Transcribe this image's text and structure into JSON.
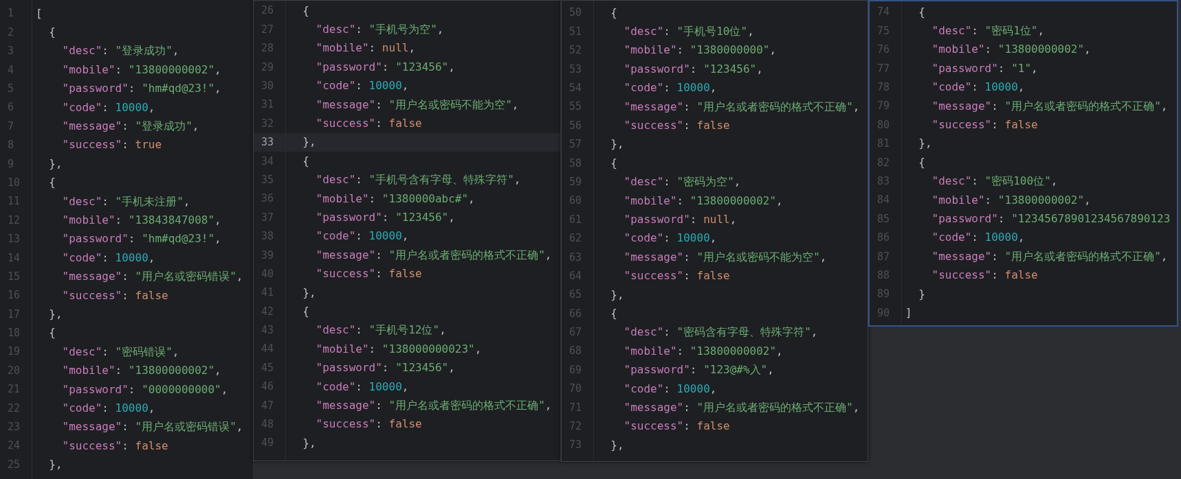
{
  "panes": [
    {
      "focused": false,
      "lines": [
        {
          "number": "1",
          "current": false,
          "tokens": [
            {
              "kind": "punct",
              "text": "["
            }
          ]
        },
        {
          "number": "2",
          "current": false,
          "tokens": [
            {
              "kind": "punct",
              "text": "  {"
            }
          ]
        },
        {
          "number": "3",
          "current": false,
          "tokens": [
            {
              "kind": "key",
              "text": "    \"desc\""
            },
            {
              "kind": "punct",
              "text": ": "
            },
            {
              "kind": "string",
              "text": "\"登录成功\""
            },
            {
              "kind": "punct",
              "text": ","
            }
          ]
        },
        {
          "number": "4",
          "current": false,
          "tokens": [
            {
              "kind": "key",
              "text": "    \"mobile\""
            },
            {
              "kind": "punct",
              "text": ": "
            },
            {
              "kind": "string",
              "text": "\"13800000002\""
            },
            {
              "kind": "punct",
              "text": ","
            }
          ]
        },
        {
          "number": "5",
          "current": false,
          "tokens": [
            {
              "kind": "key",
              "text": "    \"password\""
            },
            {
              "kind": "punct",
              "text": ": "
            },
            {
              "kind": "string",
              "text": "\"hm#qd@23!\""
            },
            {
              "kind": "punct",
              "text": ","
            }
          ]
        },
        {
          "number": "6",
          "current": false,
          "tokens": [
            {
              "kind": "key",
              "text": "    \"code\""
            },
            {
              "kind": "punct",
              "text": ": "
            },
            {
              "kind": "number",
              "text": "10000"
            },
            {
              "kind": "punct",
              "text": ","
            }
          ]
        },
        {
          "number": "7",
          "current": false,
          "tokens": [
            {
              "kind": "key",
              "text": "    \"message\""
            },
            {
              "kind": "punct",
              "text": ": "
            },
            {
              "kind": "string",
              "text": "\"登录成功\""
            },
            {
              "kind": "punct",
              "text": ","
            }
          ]
        },
        {
          "number": "8",
          "current": false,
          "tokens": [
            {
              "kind": "key",
              "text": "    \"success\""
            },
            {
              "kind": "punct",
              "text": ": "
            },
            {
              "kind": "keyword",
              "text": "true"
            }
          ]
        },
        {
          "number": "9",
          "current": false,
          "tokens": [
            {
              "kind": "punct",
              "text": "  },"
            }
          ]
        },
        {
          "number": "10",
          "current": false,
          "tokens": [
            {
              "kind": "punct",
              "text": "  {"
            }
          ]
        },
        {
          "number": "11",
          "current": false,
          "tokens": [
            {
              "kind": "key",
              "text": "    \"desc\""
            },
            {
              "kind": "punct",
              "text": ": "
            },
            {
              "kind": "string",
              "text": "\"手机未注册\""
            },
            {
              "kind": "punct",
              "text": ","
            }
          ]
        },
        {
          "number": "12",
          "current": false,
          "tokens": [
            {
              "kind": "key",
              "text": "    \"mobile\""
            },
            {
              "kind": "punct",
              "text": ": "
            },
            {
              "kind": "string",
              "text": "\"13843847008\""
            },
            {
              "kind": "punct",
              "text": ","
            }
          ]
        },
        {
          "number": "13",
          "current": false,
          "tokens": [
            {
              "kind": "key",
              "text": "    \"password\""
            },
            {
              "kind": "punct",
              "text": ": "
            },
            {
              "kind": "string",
              "text": "\"hm#qd@23!\""
            },
            {
              "kind": "punct",
              "text": ","
            }
          ]
        },
        {
          "number": "14",
          "current": false,
          "tokens": [
            {
              "kind": "key",
              "text": "    \"code\""
            },
            {
              "kind": "punct",
              "text": ": "
            },
            {
              "kind": "number",
              "text": "10000"
            },
            {
              "kind": "punct",
              "text": ","
            }
          ]
        },
        {
          "number": "15",
          "current": false,
          "tokens": [
            {
              "kind": "key",
              "text": "    \"message\""
            },
            {
              "kind": "punct",
              "text": ": "
            },
            {
              "kind": "string",
              "text": "\"用户名或密码错误\""
            },
            {
              "kind": "punct",
              "text": ","
            }
          ]
        },
        {
          "number": "16",
          "current": false,
          "tokens": [
            {
              "kind": "key",
              "text": "    \"success\""
            },
            {
              "kind": "punct",
              "text": ": "
            },
            {
              "kind": "keyword",
              "text": "false"
            }
          ]
        },
        {
          "number": "17",
          "current": false,
          "tokens": [
            {
              "kind": "punct",
              "text": "  },"
            }
          ]
        },
        {
          "number": "18",
          "current": false,
          "tokens": [
            {
              "kind": "punct",
              "text": "  {"
            }
          ]
        },
        {
          "number": "19",
          "current": false,
          "tokens": [
            {
              "kind": "key",
              "text": "    \"desc\""
            },
            {
              "kind": "punct",
              "text": ": "
            },
            {
              "kind": "string",
              "text": "\"密码错误\""
            },
            {
              "kind": "punct",
              "text": ","
            }
          ]
        },
        {
          "number": "20",
          "current": false,
          "tokens": [
            {
              "kind": "key",
              "text": "    \"mobile\""
            },
            {
              "kind": "punct",
              "text": ": "
            },
            {
              "kind": "string",
              "text": "\"13800000002\""
            },
            {
              "kind": "punct",
              "text": ","
            }
          ]
        },
        {
          "number": "21",
          "current": false,
          "tokens": [
            {
              "kind": "key",
              "text": "    \"password\""
            },
            {
              "kind": "punct",
              "text": ": "
            },
            {
              "kind": "string",
              "text": "\"0000000000\""
            },
            {
              "kind": "punct",
              "text": ","
            }
          ]
        },
        {
          "number": "22",
          "current": false,
          "tokens": [
            {
              "kind": "key",
              "text": "    \"code\""
            },
            {
              "kind": "punct",
              "text": ": "
            },
            {
              "kind": "number",
              "text": "10000"
            },
            {
              "kind": "punct",
              "text": ","
            }
          ]
        },
        {
          "number": "23",
          "current": false,
          "tokens": [
            {
              "kind": "key",
              "text": "    \"message\""
            },
            {
              "kind": "punct",
              "text": ": "
            },
            {
              "kind": "string",
              "text": "\"用户名或密码错误\""
            },
            {
              "kind": "punct",
              "text": ","
            }
          ]
        },
        {
          "number": "24",
          "current": false,
          "tokens": [
            {
              "kind": "key",
              "text": "    \"success\""
            },
            {
              "kind": "punct",
              "text": ": "
            },
            {
              "kind": "keyword",
              "text": "false"
            }
          ]
        },
        {
          "number": "25",
          "current": false,
          "tokens": [
            {
              "kind": "punct",
              "text": "  },"
            }
          ]
        }
      ]
    },
    {
      "focused": false,
      "lines": [
        {
          "number": "26",
          "current": false,
          "tokens": [
            {
              "kind": "punct",
              "text": "  {"
            }
          ]
        },
        {
          "number": "27",
          "current": false,
          "tokens": [
            {
              "kind": "key",
              "text": "    \"desc\""
            },
            {
              "kind": "punct",
              "text": ": "
            },
            {
              "kind": "string",
              "text": "\"手机号为空\""
            },
            {
              "kind": "punct",
              "text": ","
            }
          ]
        },
        {
          "number": "28",
          "current": false,
          "tokens": [
            {
              "kind": "key",
              "text": "    \"mobile\""
            },
            {
              "kind": "punct",
              "text": ": "
            },
            {
              "kind": "keyword",
              "text": "null"
            },
            {
              "kind": "punct",
              "text": ","
            }
          ]
        },
        {
          "number": "29",
          "current": false,
          "tokens": [
            {
              "kind": "key",
              "text": "    \"password\""
            },
            {
              "kind": "punct",
              "text": ": "
            },
            {
              "kind": "string",
              "text": "\"123456\""
            },
            {
              "kind": "punct",
              "text": ","
            }
          ]
        },
        {
          "number": "30",
          "current": false,
          "tokens": [
            {
              "kind": "key",
              "text": "    \"code\""
            },
            {
              "kind": "punct",
              "text": ": "
            },
            {
              "kind": "number",
              "text": "10000"
            },
            {
              "kind": "punct",
              "text": ","
            }
          ]
        },
        {
          "number": "31",
          "current": false,
          "tokens": [
            {
              "kind": "key",
              "text": "    \"message\""
            },
            {
              "kind": "punct",
              "text": ": "
            },
            {
              "kind": "string",
              "text": "\"用户名或密码不能为空\""
            },
            {
              "kind": "punct",
              "text": ","
            }
          ]
        },
        {
          "number": "32",
          "current": false,
          "tokens": [
            {
              "kind": "key",
              "text": "    \"success\""
            },
            {
              "kind": "punct",
              "text": ": "
            },
            {
              "kind": "keyword",
              "text": "false"
            }
          ]
        },
        {
          "number": "33",
          "current": true,
          "tokens": [
            {
              "kind": "punct",
              "text": "  },"
            }
          ]
        },
        {
          "number": "34",
          "current": false,
          "tokens": [
            {
              "kind": "punct",
              "text": "  {"
            }
          ]
        },
        {
          "number": "35",
          "current": false,
          "tokens": [
            {
              "kind": "key",
              "text": "    \"desc\""
            },
            {
              "kind": "punct",
              "text": ": "
            },
            {
              "kind": "string",
              "text": "\"手机号含有字母、特殊字符\""
            },
            {
              "kind": "punct",
              "text": ","
            }
          ]
        },
        {
          "number": "36",
          "current": false,
          "tokens": [
            {
              "kind": "key",
              "text": "    \"mobile\""
            },
            {
              "kind": "punct",
              "text": ": "
            },
            {
              "kind": "string",
              "text": "\"1380000abc#\""
            },
            {
              "kind": "punct",
              "text": ","
            }
          ]
        },
        {
          "number": "37",
          "current": false,
          "tokens": [
            {
              "kind": "key",
              "text": "    \"password\""
            },
            {
              "kind": "punct",
              "text": ": "
            },
            {
              "kind": "string",
              "text": "\"123456\""
            },
            {
              "kind": "punct",
              "text": ","
            }
          ]
        },
        {
          "number": "38",
          "current": false,
          "tokens": [
            {
              "kind": "key",
              "text": "    \"code\""
            },
            {
              "kind": "punct",
              "text": ": "
            },
            {
              "kind": "number",
              "text": "10000"
            },
            {
              "kind": "punct",
              "text": ","
            }
          ]
        },
        {
          "number": "39",
          "current": false,
          "tokens": [
            {
              "kind": "key",
              "text": "    \"message\""
            },
            {
              "kind": "punct",
              "text": ": "
            },
            {
              "kind": "string",
              "text": "\"用户名或者密码的格式不正确\""
            },
            {
              "kind": "punct",
              "text": ","
            }
          ]
        },
        {
          "number": "40",
          "current": false,
          "tokens": [
            {
              "kind": "key",
              "text": "    \"success\""
            },
            {
              "kind": "punct",
              "text": ": "
            },
            {
              "kind": "keyword",
              "text": "false"
            }
          ]
        },
        {
          "number": "41",
          "current": false,
          "tokens": [
            {
              "kind": "punct",
              "text": "  },"
            }
          ]
        },
        {
          "number": "42",
          "current": false,
          "tokens": [
            {
              "kind": "punct",
              "text": "  {"
            }
          ]
        },
        {
          "number": "43",
          "current": false,
          "tokens": [
            {
              "kind": "key",
              "text": "    \"desc\""
            },
            {
              "kind": "punct",
              "text": ": "
            },
            {
              "kind": "string",
              "text": "\"手机号12位\""
            },
            {
              "kind": "punct",
              "text": ","
            }
          ]
        },
        {
          "number": "44",
          "current": false,
          "tokens": [
            {
              "kind": "key",
              "text": "    \"mobile\""
            },
            {
              "kind": "punct",
              "text": ": "
            },
            {
              "kind": "string",
              "text": "\"138000000023\""
            },
            {
              "kind": "punct",
              "text": ","
            }
          ]
        },
        {
          "number": "45",
          "current": false,
          "tokens": [
            {
              "kind": "key",
              "text": "    \"password\""
            },
            {
              "kind": "punct",
              "text": ": "
            },
            {
              "kind": "string",
              "text": "\"123456\""
            },
            {
              "kind": "punct",
              "text": ","
            }
          ]
        },
        {
          "number": "46",
          "current": false,
          "tokens": [
            {
              "kind": "key",
              "text": "    \"code\""
            },
            {
              "kind": "punct",
              "text": ": "
            },
            {
              "kind": "number",
              "text": "10000"
            },
            {
              "kind": "punct",
              "text": ","
            }
          ]
        },
        {
          "number": "47",
          "current": false,
          "tokens": [
            {
              "kind": "key",
              "text": "    \"message\""
            },
            {
              "kind": "punct",
              "text": ": "
            },
            {
              "kind": "string",
              "text": "\"用户名或者密码的格式不正确\""
            },
            {
              "kind": "punct",
              "text": ","
            }
          ]
        },
        {
          "number": "48",
          "current": false,
          "tokens": [
            {
              "kind": "key",
              "text": "    \"success\""
            },
            {
              "kind": "punct",
              "text": ": "
            },
            {
              "kind": "keyword",
              "text": "false"
            }
          ]
        },
        {
          "number": "49",
          "current": false,
          "tokens": [
            {
              "kind": "punct",
              "text": "  },"
            }
          ]
        }
      ]
    },
    {
      "focused": false,
      "lines": [
        {
          "number": "50",
          "current": false,
          "tokens": [
            {
              "kind": "punct",
              "text": "  {"
            }
          ]
        },
        {
          "number": "51",
          "current": false,
          "tokens": [
            {
              "kind": "key",
              "text": "    \"desc\""
            },
            {
              "kind": "punct",
              "text": ": "
            },
            {
              "kind": "string",
              "text": "\"手机号10位\""
            },
            {
              "kind": "punct",
              "text": ","
            }
          ]
        },
        {
          "number": "52",
          "current": false,
          "tokens": [
            {
              "kind": "key",
              "text": "    \"mobile\""
            },
            {
              "kind": "punct",
              "text": ": "
            },
            {
              "kind": "string",
              "text": "\"1380000000\""
            },
            {
              "kind": "punct",
              "text": ","
            }
          ]
        },
        {
          "number": "53",
          "current": false,
          "tokens": [
            {
              "kind": "key",
              "text": "    \"password\""
            },
            {
              "kind": "punct",
              "text": ": "
            },
            {
              "kind": "string",
              "text": "\"123456\""
            },
            {
              "kind": "punct",
              "text": ","
            }
          ]
        },
        {
          "number": "54",
          "current": false,
          "tokens": [
            {
              "kind": "key",
              "text": "    \"code\""
            },
            {
              "kind": "punct",
              "text": ": "
            },
            {
              "kind": "number",
              "text": "10000"
            },
            {
              "kind": "punct",
              "text": ","
            }
          ]
        },
        {
          "number": "55",
          "current": false,
          "tokens": [
            {
              "kind": "key",
              "text": "    \"message\""
            },
            {
              "kind": "punct",
              "text": ": "
            },
            {
              "kind": "string",
              "text": "\"用户名或者密码的格式不正确\""
            },
            {
              "kind": "punct",
              "text": ","
            }
          ]
        },
        {
          "number": "56",
          "current": false,
          "tokens": [
            {
              "kind": "key",
              "text": "    \"success\""
            },
            {
              "kind": "punct",
              "text": ": "
            },
            {
              "kind": "keyword",
              "text": "false"
            }
          ]
        },
        {
          "number": "57",
          "current": false,
          "tokens": [
            {
              "kind": "punct",
              "text": "  },"
            }
          ]
        },
        {
          "number": "58",
          "current": false,
          "tokens": [
            {
              "kind": "punct",
              "text": "  {"
            }
          ]
        },
        {
          "number": "59",
          "current": false,
          "tokens": [
            {
              "kind": "key",
              "text": "    \"desc\""
            },
            {
              "kind": "punct",
              "text": ": "
            },
            {
              "kind": "string",
              "text": "\"密码为空\""
            },
            {
              "kind": "punct",
              "text": ","
            }
          ]
        },
        {
          "number": "60",
          "current": false,
          "tokens": [
            {
              "kind": "key",
              "text": "    \"mobile\""
            },
            {
              "kind": "punct",
              "text": ": "
            },
            {
              "kind": "string",
              "text": "\"13800000002\""
            },
            {
              "kind": "punct",
              "text": ","
            }
          ]
        },
        {
          "number": "61",
          "current": false,
          "tokens": [
            {
              "kind": "key",
              "text": "    \"password\""
            },
            {
              "kind": "punct",
              "text": ": "
            },
            {
              "kind": "keyword",
              "text": "null"
            },
            {
              "kind": "punct",
              "text": ","
            }
          ]
        },
        {
          "number": "62",
          "current": false,
          "tokens": [
            {
              "kind": "key",
              "text": "    \"code\""
            },
            {
              "kind": "punct",
              "text": ": "
            },
            {
              "kind": "number",
              "text": "10000"
            },
            {
              "kind": "punct",
              "text": ","
            }
          ]
        },
        {
          "number": "63",
          "current": false,
          "tokens": [
            {
              "kind": "key",
              "text": "    \"message\""
            },
            {
              "kind": "punct",
              "text": ": "
            },
            {
              "kind": "string",
              "text": "\"用户名或密码不能为空\""
            },
            {
              "kind": "punct",
              "text": ","
            }
          ]
        },
        {
          "number": "64",
          "current": false,
          "tokens": [
            {
              "kind": "key",
              "text": "    \"success\""
            },
            {
              "kind": "punct",
              "text": ": "
            },
            {
              "kind": "keyword",
              "text": "false"
            }
          ]
        },
        {
          "number": "65",
          "current": false,
          "tokens": [
            {
              "kind": "punct",
              "text": "  },"
            }
          ]
        },
        {
          "number": "66",
          "current": false,
          "tokens": [
            {
              "kind": "punct",
              "text": "  {"
            }
          ]
        },
        {
          "number": "67",
          "current": false,
          "tokens": [
            {
              "kind": "key",
              "text": "    \"desc\""
            },
            {
              "kind": "punct",
              "text": ": "
            },
            {
              "kind": "string",
              "text": "\"密码含有字母、特殊字符\""
            },
            {
              "kind": "punct",
              "text": ","
            }
          ]
        },
        {
          "number": "68",
          "current": false,
          "tokens": [
            {
              "kind": "key",
              "text": "    \"mobile\""
            },
            {
              "kind": "punct",
              "text": ": "
            },
            {
              "kind": "string",
              "text": "\"13800000002\""
            },
            {
              "kind": "punct",
              "text": ","
            }
          ]
        },
        {
          "number": "69",
          "current": false,
          "tokens": [
            {
              "kind": "key",
              "text": "    \"password\""
            },
            {
              "kind": "punct",
              "text": ": "
            },
            {
              "kind": "string",
              "text": "\"123@#%入\""
            },
            {
              "kind": "punct",
              "text": ","
            }
          ]
        },
        {
          "number": "70",
          "current": false,
          "tokens": [
            {
              "kind": "key",
              "text": "    \"code\""
            },
            {
              "kind": "punct",
              "text": ": "
            },
            {
              "kind": "number",
              "text": "10000"
            },
            {
              "kind": "punct",
              "text": ","
            }
          ]
        },
        {
          "number": "71",
          "current": false,
          "tokens": [
            {
              "kind": "key",
              "text": "    \"message\""
            },
            {
              "kind": "punct",
              "text": ": "
            },
            {
              "kind": "string",
              "text": "\"用户名或者密码的格式不正确\""
            },
            {
              "kind": "punct",
              "text": ","
            }
          ]
        },
        {
          "number": "72",
          "current": false,
          "tokens": [
            {
              "kind": "key",
              "text": "    \"success\""
            },
            {
              "kind": "punct",
              "text": ": "
            },
            {
              "kind": "keyword",
              "text": "false"
            }
          ]
        },
        {
          "number": "73",
          "current": false,
          "tokens": [
            {
              "kind": "punct",
              "text": "  },"
            }
          ]
        }
      ]
    },
    {
      "focused": true,
      "lines": [
        {
          "number": "74",
          "current": false,
          "tokens": [
            {
              "kind": "punct",
              "text": "  {"
            }
          ]
        },
        {
          "number": "75",
          "current": false,
          "tokens": [
            {
              "kind": "key",
              "text": "    \"desc\""
            },
            {
              "kind": "punct",
              "text": ": "
            },
            {
              "kind": "string",
              "text": "\"密码1位\""
            },
            {
              "kind": "punct",
              "text": ","
            }
          ]
        },
        {
          "number": "76",
          "current": false,
          "tokens": [
            {
              "kind": "key",
              "text": "    \"mobile\""
            },
            {
              "kind": "punct",
              "text": ": "
            },
            {
              "kind": "string",
              "text": "\"13800000002\""
            },
            {
              "kind": "punct",
              "text": ","
            }
          ]
        },
        {
          "number": "77",
          "current": false,
          "tokens": [
            {
              "kind": "key",
              "text": "    \"password\""
            },
            {
              "kind": "punct",
              "text": ": "
            },
            {
              "kind": "string",
              "text": "\"1\""
            },
            {
              "kind": "punct",
              "text": ","
            }
          ]
        },
        {
          "number": "78",
          "current": false,
          "tokens": [
            {
              "kind": "key",
              "text": "    \"code\""
            },
            {
              "kind": "punct",
              "text": ": "
            },
            {
              "kind": "number",
              "text": "10000"
            },
            {
              "kind": "punct",
              "text": ","
            }
          ]
        },
        {
          "number": "79",
          "current": false,
          "tokens": [
            {
              "kind": "key",
              "text": "    \"message\""
            },
            {
              "kind": "punct",
              "text": ": "
            },
            {
              "kind": "string",
              "text": "\"用户名或者密码的格式不正确\""
            },
            {
              "kind": "punct",
              "text": ","
            }
          ]
        },
        {
          "number": "80",
          "current": false,
          "tokens": [
            {
              "kind": "key",
              "text": "    \"success\""
            },
            {
              "kind": "punct",
              "text": ": "
            },
            {
              "kind": "keyword",
              "text": "false"
            }
          ]
        },
        {
          "number": "81",
          "current": false,
          "tokens": [
            {
              "kind": "punct",
              "text": "  },"
            }
          ]
        },
        {
          "number": "82",
          "current": false,
          "tokens": [
            {
              "kind": "punct",
              "text": "  {"
            }
          ]
        },
        {
          "number": "83",
          "current": false,
          "tokens": [
            {
              "kind": "key",
              "text": "    \"desc\""
            },
            {
              "kind": "punct",
              "text": ": "
            },
            {
              "kind": "string",
              "text": "\"密码100位\""
            },
            {
              "kind": "punct",
              "text": ","
            }
          ]
        },
        {
          "number": "84",
          "current": false,
          "tokens": [
            {
              "kind": "key",
              "text": "    \"mobile\""
            },
            {
              "kind": "punct",
              "text": ": "
            },
            {
              "kind": "string",
              "text": "\"13800000002\""
            },
            {
              "kind": "punct",
              "text": ","
            }
          ]
        },
        {
          "number": "85",
          "current": false,
          "tokens": [
            {
              "kind": "key",
              "text": "    \"password\""
            },
            {
              "kind": "punct",
              "text": ": "
            },
            {
              "kind": "string",
              "text": "\"12345678901234567890123"
            }
          ]
        },
        {
          "number": "86",
          "current": false,
          "tokens": [
            {
              "kind": "key",
              "text": "    \"code\""
            },
            {
              "kind": "punct",
              "text": ": "
            },
            {
              "kind": "number",
              "text": "10000"
            },
            {
              "kind": "punct",
              "text": ","
            }
          ]
        },
        {
          "number": "87",
          "current": false,
          "tokens": [
            {
              "kind": "key",
              "text": "    \"message\""
            },
            {
              "kind": "punct",
              "text": ": "
            },
            {
              "kind": "string",
              "text": "\"用户名或者密码的格式不正确\""
            },
            {
              "kind": "punct",
              "text": ","
            }
          ]
        },
        {
          "number": "88",
          "current": false,
          "tokens": [
            {
              "kind": "key",
              "text": "    \"success\""
            },
            {
              "kind": "punct",
              "text": ": "
            },
            {
              "kind": "keyword",
              "text": "false"
            }
          ]
        },
        {
          "number": "89",
          "current": false,
          "tokens": [
            {
              "kind": "punct",
              "text": "  }"
            }
          ]
        },
        {
          "number": "90",
          "current": false,
          "tokens": [
            {
              "kind": "punct",
              "text": "]"
            }
          ]
        }
      ]
    }
  ]
}
